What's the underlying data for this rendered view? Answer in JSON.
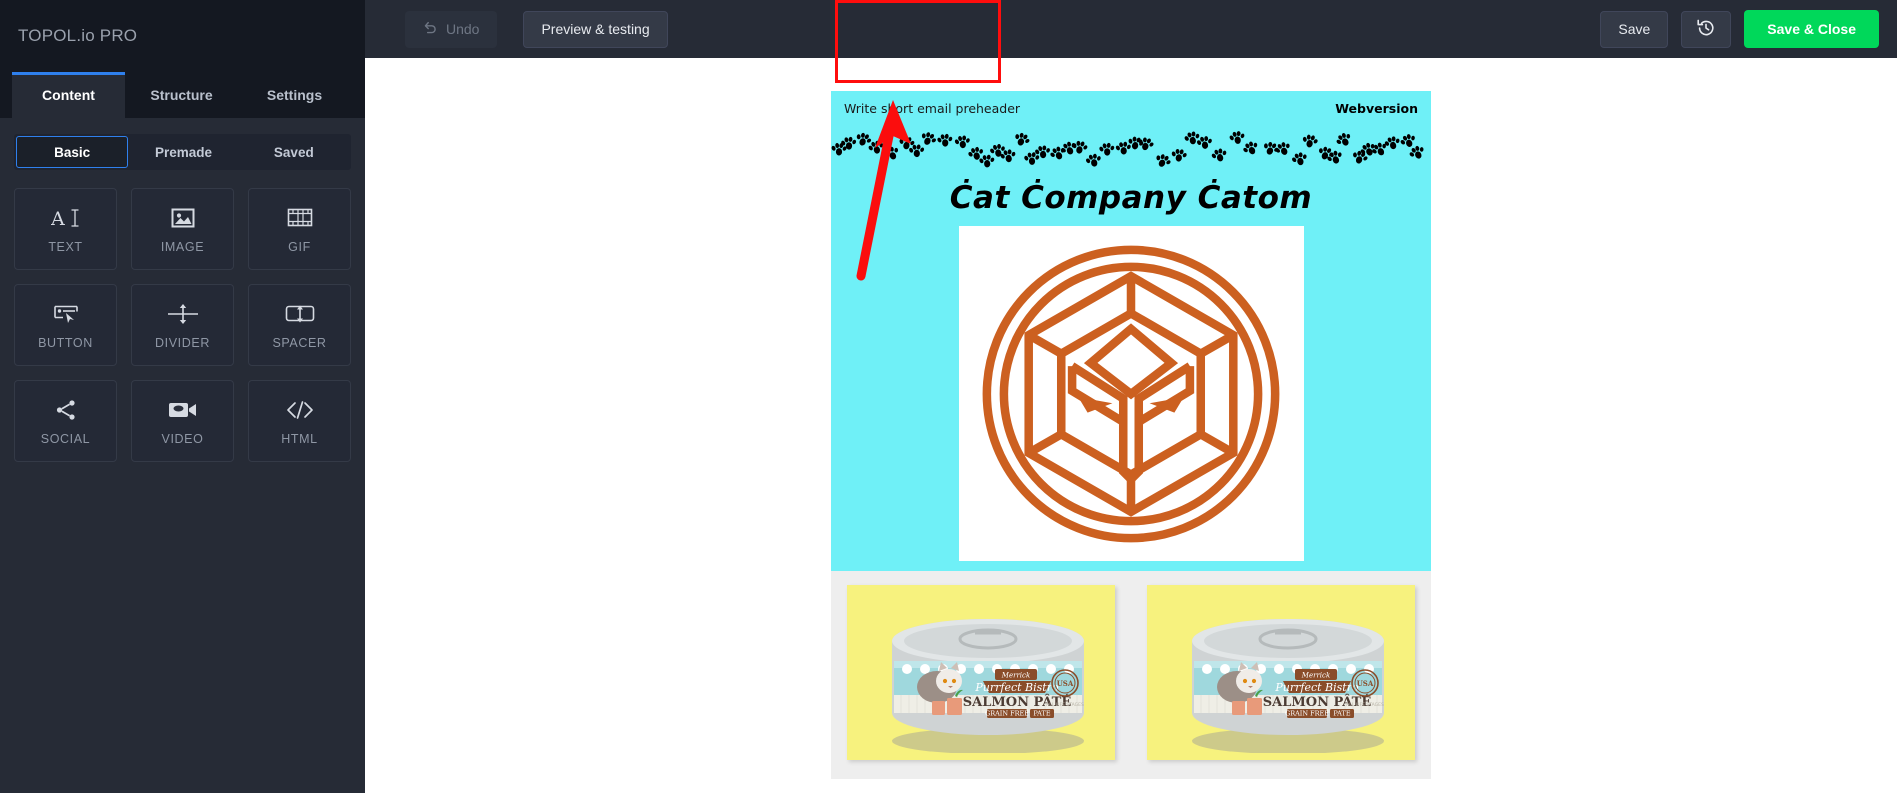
{
  "sidebar": {
    "brand": "TOPOL.io PRO",
    "tabs": [
      {
        "label": "Content",
        "active": true
      },
      {
        "label": "Structure",
        "active": false
      },
      {
        "label": "Settings",
        "active": false
      }
    ],
    "subtabs": [
      {
        "label": "Basic",
        "active": true
      },
      {
        "label": "Premade",
        "active": false
      },
      {
        "label": "Saved",
        "active": false
      }
    ],
    "blocks": [
      {
        "label": "TEXT",
        "icon": "text-icon"
      },
      {
        "label": "IMAGE",
        "icon": "image-icon"
      },
      {
        "label": "GIF",
        "icon": "gif-icon"
      },
      {
        "label": "BUTTON",
        "icon": "button-icon"
      },
      {
        "label": "DIVIDER",
        "icon": "divider-icon"
      },
      {
        "label": "SPACER",
        "icon": "spacer-icon"
      },
      {
        "label": "SOCIAL",
        "icon": "social-share-icon"
      },
      {
        "label": "VIDEO",
        "icon": "video-camera-icon"
      },
      {
        "label": "HTML",
        "icon": "code-icon"
      }
    ]
  },
  "toolbar": {
    "undo_label": "Undo",
    "preview_label": "Preview & testing",
    "save_label": "Save",
    "history_label": "",
    "save_close_label": "Save & Close"
  },
  "email": {
    "preheader": "Write short email preheader",
    "webversion": "Webversion",
    "title": "Ċat Ċompany Ċatom",
    "logo_alt": "geometric-lion-head-logo",
    "products": [
      {
        "name": "Merrick Purrfect Bistro Salmon Pâté"
      },
      {
        "name": "Merrick Purrfect Bistro Salmon Pâté"
      }
    ],
    "can": {
      "brand": "Merrick",
      "line": "Purrfect Bistro",
      "flavor": "SALMON PÂTÉ",
      "tag1": "GRAIN FREE",
      "tag2": "PATE",
      "badge": "USA",
      "footnote": "ALL LIFE STAGES"
    }
  },
  "colors": {
    "accent_blue": "#2f80ed",
    "save_close_green": "#00d85a",
    "annotation_red": "#ff0d0d",
    "email_cyan": "#6ff0f7",
    "logo_orange": "#cc6020",
    "can_yellow": "#f7f27e"
  },
  "annotation": {
    "highlight_target": "preview-and-testing-button",
    "arrow_points_to": "preview-and-testing-button"
  }
}
